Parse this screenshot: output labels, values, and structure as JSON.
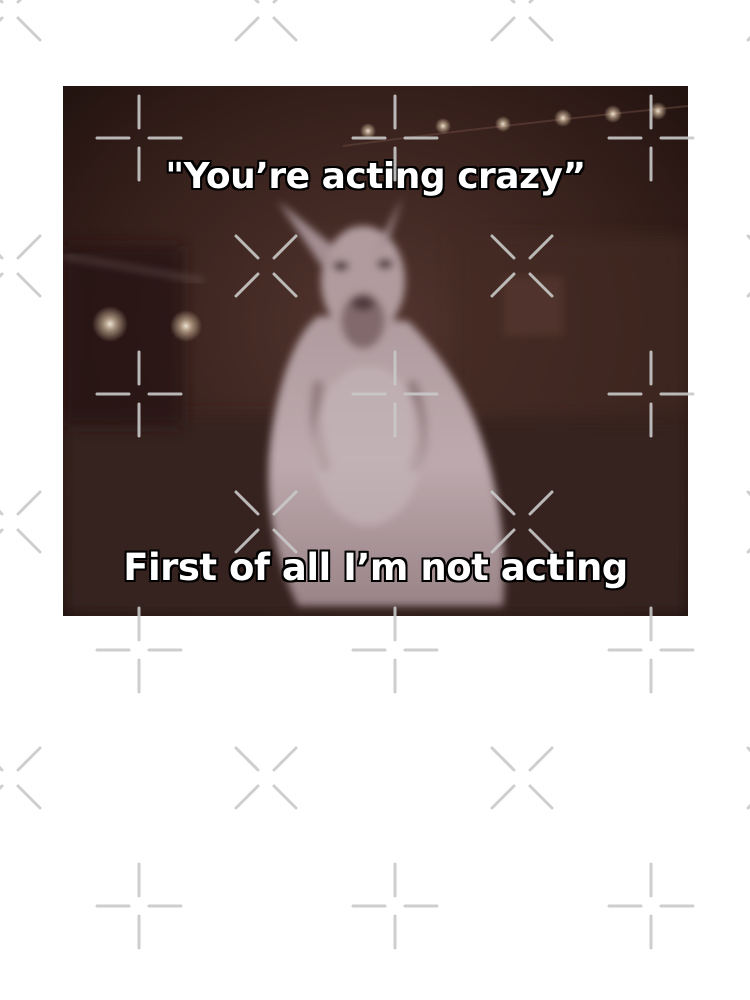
{
  "meme": {
    "top_caption": "\"You’re acting crazy”",
    "bottom_caption": "First of all I’m not acting"
  },
  "watermark": {
    "pattern_color": "#c9c9c9",
    "icon_names": [
      "x-mark-icon",
      "plus-mark-icon"
    ]
  },
  "colors": {
    "background": "#ffffff",
    "photo_dark": "#2a1714",
    "caption_fill": "#ffffff",
    "caption_outline": "#000000"
  }
}
